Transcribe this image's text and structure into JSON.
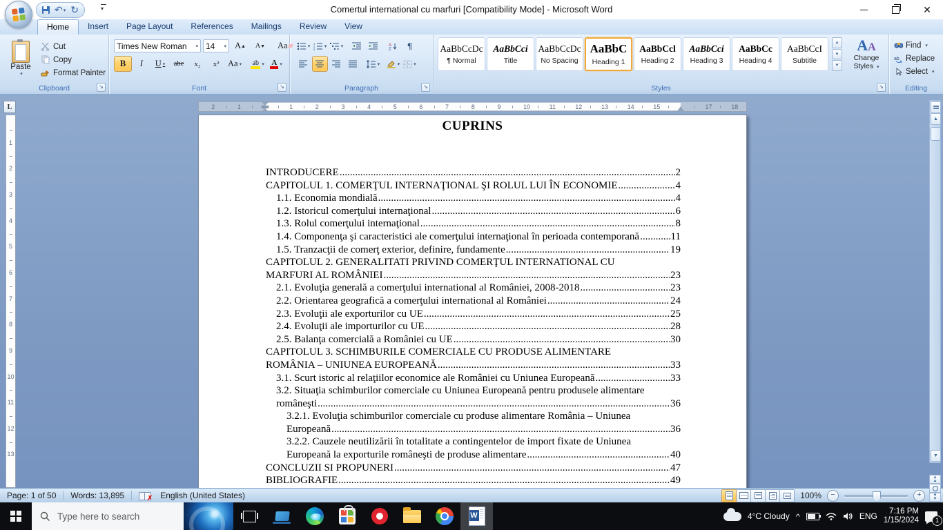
{
  "window": {
    "title": "Comertul  international cu marfuri [Compatibility Mode] - Microsoft Word"
  },
  "ribbon": {
    "tabs": [
      "Home",
      "Insert",
      "Page Layout",
      "References",
      "Mailings",
      "Review",
      "View"
    ],
    "active_tab": "Home",
    "clipboard": {
      "label": "Clipboard",
      "paste": "Paste",
      "cut": "Cut",
      "copy": "Copy",
      "format_painter": "Format Painter"
    },
    "font": {
      "label": "Font",
      "font_name": "Times New Roman",
      "font_size": "14"
    },
    "paragraph": {
      "label": "Paragraph"
    },
    "styles": {
      "label": "Styles",
      "change_styles_1": "Change",
      "change_styles_2": "Styles"
    },
    "editing": {
      "label": "Editing",
      "find": "Find",
      "replace": "Replace",
      "select": "Select"
    }
  },
  "icons": {
    "bold": "B",
    "italic": "I",
    "underline": "U",
    "strike": "abe",
    "subscript": "x₂",
    "superscript": "x²",
    "case": "Aa",
    "highlight": "ab",
    "font_color": "A",
    "grow": "A",
    "shrink": "A",
    "clear": "Aa",
    "pilcrow": "¶",
    "undo": "↶",
    "redo": "↻",
    "sort": "A↓",
    "scroll_up": "▲",
    "scroll_down": "▼",
    "dbl_up": "▲▲",
    "dbl_down": "▼▼",
    "minus": "−",
    "plus": "+",
    "chevron_up": "^",
    "cs_a1": "A",
    "cs_a2": "A"
  },
  "styles_gallery": [
    {
      "sample": "AaBbCcDc",
      "label": "¶ Normal",
      "bold": false,
      "italic": false,
      "big": false,
      "selected": false
    },
    {
      "sample": "AaBbCci",
      "label": "Title",
      "bold": true,
      "italic": true,
      "big": false,
      "selected": false
    },
    {
      "sample": "AaBbCcDc",
      "label": "No Spacing",
      "bold": false,
      "italic": false,
      "big": false,
      "selected": false
    },
    {
      "sample": "AaBbC",
      "label": "Heading 1",
      "bold": true,
      "italic": false,
      "big": true,
      "selected": true
    },
    {
      "sample": "AaBbCcl",
      "label": "Heading 2",
      "bold": true,
      "italic": false,
      "big": false,
      "selected": false
    },
    {
      "sample": "AaBbCci",
      "label": "Heading 3",
      "bold": true,
      "italic": true,
      "big": false,
      "selected": false
    },
    {
      "sample": "AaBbCc",
      "label": "Heading 4",
      "bold": true,
      "italic": false,
      "big": false,
      "selected": false
    },
    {
      "sample": "AaBbCcI",
      "label": "Subtitle",
      "bold": false,
      "italic": false,
      "big": false,
      "selected": false
    }
  ],
  "document": {
    "page_title": "CUPRINS",
    "toc": [
      {
        "indent": 0,
        "pre": [],
        "text": "INTRODUCERE",
        "page": "2"
      },
      {
        "indent": 0,
        "pre": [],
        "text": "CAPITOLUL 1. COMERŢUL INTERNAŢIONAL ŞI ROLUL LUI ÎN ECONOMIE",
        "page": "4"
      },
      {
        "indent": 1,
        "pre": [],
        "text": "1.1. Economia mondială",
        "page": "4"
      },
      {
        "indent": 1,
        "pre": [],
        "text": "1.2. Istoricul comerţului internaţional",
        "page": "6"
      },
      {
        "indent": 1,
        "pre": [],
        "text": "1.3. Rolul comerţului internaţional",
        "page": "8"
      },
      {
        "indent": 1,
        "pre": [],
        "text": "1.4. Componenţa şi caracteristici ale comerţului internaţional în perioada contemporană",
        "page": "11"
      },
      {
        "indent": 1,
        "pre": [],
        "text": "1.5. Tranzacţii de comerţ exterior, definire, fundamente",
        "page": "19"
      },
      {
        "indent": 0,
        "pre": [
          "CAPITOLUL 2. GENERALITATI PRIVIND COMERŢUL INTERNATIONAL CU"
        ],
        "text": "MARFURI AL ROMÂNIEI",
        "page": "23"
      },
      {
        "indent": 1,
        "pre": [],
        "text": "2.1. Evoluţia generală a comerţului international al României, 2008-2018",
        "page": "23"
      },
      {
        "indent": 1,
        "pre": [],
        "text": "2.2. Orientarea geografică a comerţului international al României",
        "page": "24"
      },
      {
        "indent": 1,
        "pre": [],
        "text": "2.3. Evoluţii ale exporturilor cu UE",
        "page": "25"
      },
      {
        "indent": 1,
        "pre": [],
        "text": "2.4. Evoluţii ale importurilor cu UE",
        "page": "28"
      },
      {
        "indent": 1,
        "pre": [],
        "text": "2.5. Balanţa comercială a României cu UE",
        "page": "30"
      },
      {
        "indent": 0,
        "pre": [
          "CAPITOLUL 3. SCHIMBURILE COMERCIALE CU PRODUSE ALIMENTARE"
        ],
        "text": "ROMÂNIA – UNIUNEA EUROPEANĂ",
        "page": "33"
      },
      {
        "indent": 1,
        "pre": [],
        "text": "3.1. Scurt istoric al relaţiilor economice ale României cu Uniunea Europeană",
        "page": "33"
      },
      {
        "indent": 1,
        "pre": [
          "3.2. Situaţia schimburilor comerciale cu Uniunea Europeană pentru produsele alimentare"
        ],
        "text": "româneşti",
        "page": "36"
      },
      {
        "indent": 2,
        "pre": [
          "3.2.1. Evoluţia schimburilor comerciale cu produse alimentare România – Uniunea"
        ],
        "text": "Europeană",
        "page": "36"
      },
      {
        "indent": 2,
        "pre": [
          "3.2.2. Cauzele neutilizării în totalitate a contingentelor de import fixate de Uniunea"
        ],
        "text": "Europeană la exporturile româneşti de produse alimentare",
        "page": "40"
      },
      {
        "indent": 0,
        "pre": [],
        "text": "CONCLUZII SI PROPUNERI",
        "page": "47"
      },
      {
        "indent": 0,
        "pre": [],
        "text": "BIBLIOGRAFIE",
        "page": "49"
      }
    ]
  },
  "ruler": {
    "left_numbers": [
      "1",
      "2"
    ],
    "main_numbers": [
      "1",
      "2",
      "3",
      "4",
      "5",
      "6",
      "7",
      "8",
      "9",
      "10",
      "11",
      "12",
      "13",
      "14",
      "15"
    ],
    "right_numbers": [
      "17",
      "18"
    ],
    "v_numbers": [
      "1",
      "2",
      "3",
      "4",
      "5",
      "6",
      "7",
      "8",
      "9",
      "10",
      "11",
      "12",
      "13"
    ],
    "tab_selector": "L"
  },
  "status_bar": {
    "page": "Page: 1 of 50",
    "words": "Words: 13,895",
    "language": "English (United States)",
    "zoom": "100%"
  },
  "taskbar": {
    "search_placeholder": "Type here to search",
    "weather": "4°C  Cloudy",
    "language": "ENG",
    "time": "7:16 PM",
    "date": "1/15/2024",
    "notification_count": "1"
  },
  "colors": {
    "ribbon_blue": "#d9e8f8",
    "doc_background": "#8aa4c9",
    "selection_orange": "#fdc658",
    "taskbar_black": "#0c0d10",
    "font_color_red": "#e00000",
    "highlight_yellow": "#ffe400"
  }
}
